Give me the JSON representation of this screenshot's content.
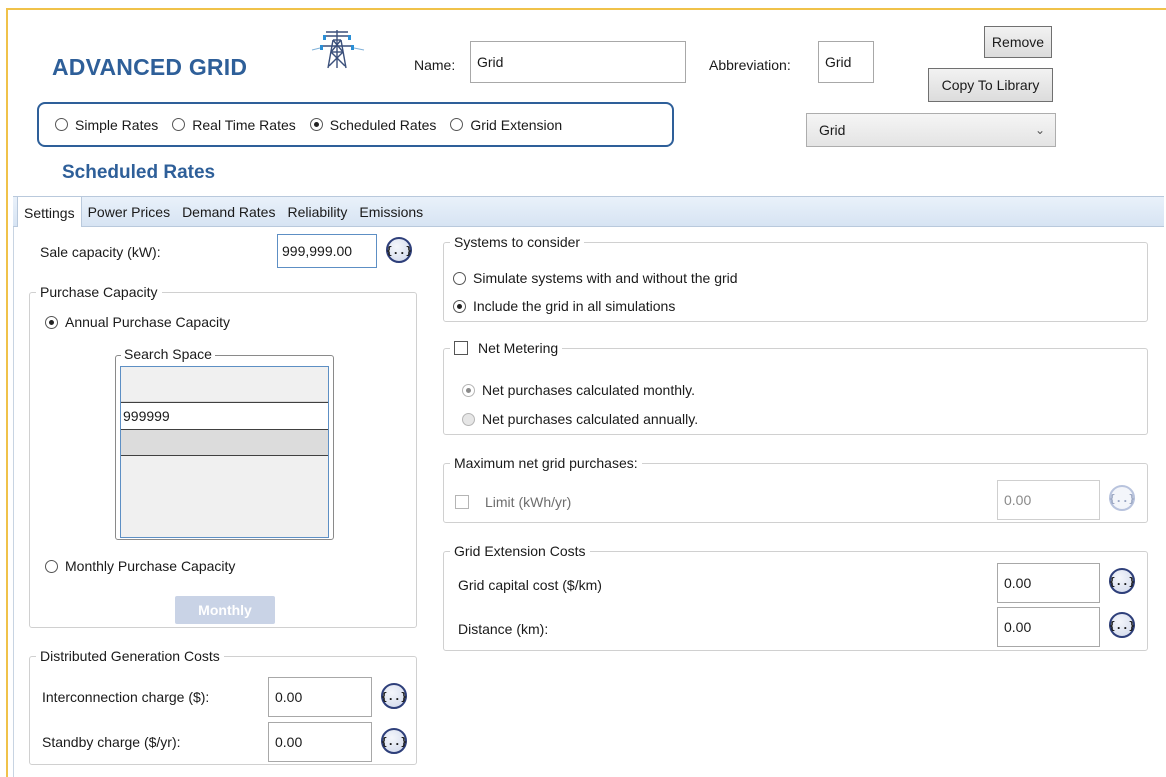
{
  "header": {
    "title": "ADVANCED GRID",
    "name_label": "Name:",
    "name_value": "Grid",
    "abbrev_label": "Abbreviation:",
    "abbrev_value": "Grid",
    "remove_label": "Remove",
    "copy_label": "Copy To Library",
    "library_select": "Grid"
  },
  "modes": [
    {
      "label": "Simple Rates",
      "selected": false
    },
    {
      "label": "Real Time Rates",
      "selected": false
    },
    {
      "label": "Scheduled Rates",
      "selected": true
    },
    {
      "label": "Grid Extension",
      "selected": false
    }
  ],
  "section_title": "Scheduled Rates",
  "tabs": [
    "Settings",
    "Power Prices",
    "Demand Rates",
    "Reliability",
    "Emissions"
  ],
  "settings": {
    "sale_capacity_label": "Sale capacity (kW):",
    "sale_capacity_value": "999,999.00",
    "purchase_capacity": {
      "legend": "Purchase Capacity",
      "annual_label": "Annual Purchase Capacity",
      "search_space_legend": "Search Space",
      "search_space_values": [
        "999999",
        ""
      ],
      "monthly_label": "Monthly Purchase Capacity",
      "monthly_button": "Monthly"
    },
    "dg_costs": {
      "legend": "Distributed Generation Costs",
      "interconnection_label": "Interconnection charge ($):",
      "interconnection_value": "0.00",
      "standby_label": "Standby charge ($/yr):",
      "standby_value": "0.00"
    },
    "systems": {
      "legend": "Systems to consider",
      "option1": "Simulate systems with and without the grid",
      "option2": "Include the grid in all simulations"
    },
    "net_metering": {
      "label": "Net Metering",
      "monthly": "Net purchases calculated monthly.",
      "annually": "Net purchases calculated annually."
    },
    "max_net": {
      "legend": "Maximum net grid purchases:",
      "limit_label": "Limit (kWh/yr)",
      "limit_value": "0.00"
    },
    "extension": {
      "legend": "Grid Extension Costs",
      "capital_label": "Grid capital cost ($/km)",
      "capital_value": "0.00",
      "distance_label": "Distance (km):",
      "distance_value": "0.00"
    }
  },
  "icons": {
    "fx": "{..}",
    "chevron": "⌄"
  },
  "colors": {
    "accent": "#2e5f99",
    "window_border": "#f0c24a"
  }
}
